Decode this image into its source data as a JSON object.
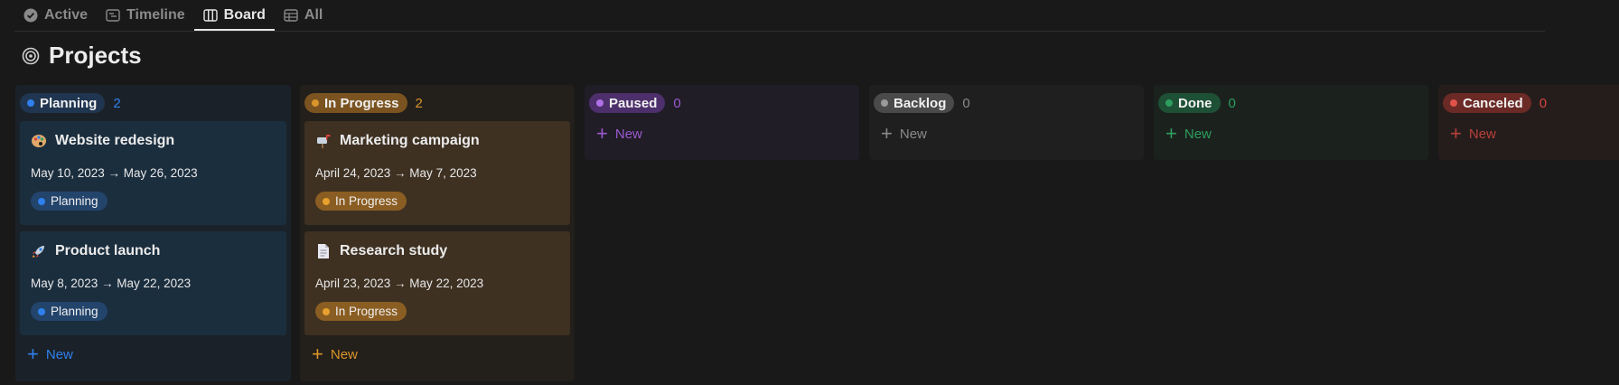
{
  "tabs": [
    {
      "label": "Active",
      "icon": "check-circle-icon"
    },
    {
      "label": "Timeline",
      "icon": "timeline-icon"
    },
    {
      "label": "Board",
      "icon": "board-icon"
    },
    {
      "label": "All",
      "icon": "table-icon"
    }
  ],
  "page": {
    "title": "Projects",
    "icon": "target-icon"
  },
  "columns": [
    {
      "label": "Planning",
      "count": "2",
      "color": "#2f80ed",
      "cards": [
        {
          "title": "Website redesign",
          "emoji": "palette-icon",
          "dates": "May 10, 2023 → May 26, 2023",
          "status": "Planning"
        },
        {
          "title": "Product launch",
          "emoji": "rocket-icon",
          "dates": "May 8, 2023 → May 22, 2023",
          "status": "Planning"
        }
      ],
      "new_label": "New"
    },
    {
      "label": "In Progress",
      "count": "2",
      "color": "#d9952a",
      "cards": [
        {
          "title": "Marketing campaign",
          "emoji": "mailbox-icon",
          "dates": "April 24, 2023 → May 7, 2023",
          "status": "In Progress"
        },
        {
          "title": "Research study",
          "emoji": "document-icon",
          "dates": "April 23, 2023 → May 22, 2023",
          "status": "In Progress"
        }
      ],
      "new_label": "New"
    },
    {
      "label": "Paused",
      "count": "0",
      "color": "#9b59d0",
      "cards": [],
      "new_label": "New"
    },
    {
      "label": "Backlog",
      "count": "0",
      "color": "#8a8a8a",
      "cards": [],
      "new_label": "New"
    },
    {
      "label": "Done",
      "count": "0",
      "color": "#2e9e5e",
      "cards": [],
      "new_label": "New"
    },
    {
      "label": "Canceled",
      "count": "0",
      "color": "#d9453d",
      "cards": [],
      "new_label": "New"
    }
  ]
}
